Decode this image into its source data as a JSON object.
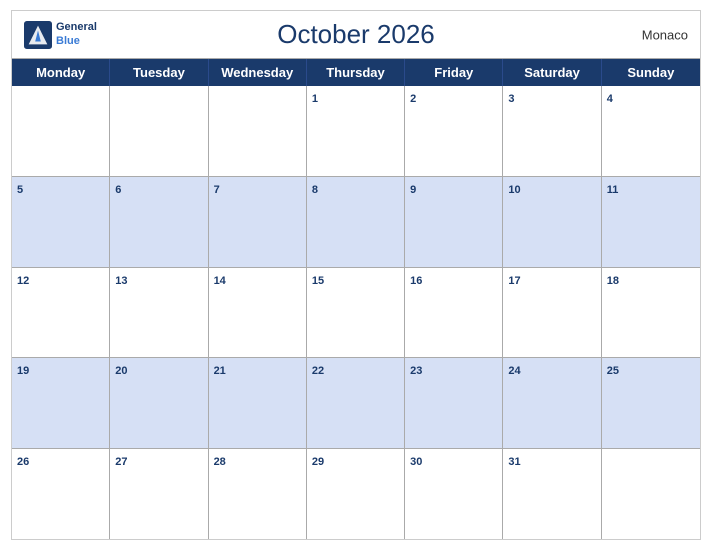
{
  "header": {
    "title": "October 2026",
    "country": "Monaco",
    "logo_general": "General",
    "logo_blue": "Blue"
  },
  "dayHeaders": [
    "Monday",
    "Tuesday",
    "Wednesday",
    "Thursday",
    "Friday",
    "Saturday",
    "Sunday"
  ],
  "weeks": [
    {
      "dark": false,
      "days": [
        {
          "num": "",
          "empty": true
        },
        {
          "num": "",
          "empty": true
        },
        {
          "num": "",
          "empty": true
        },
        {
          "num": "1"
        },
        {
          "num": "2"
        },
        {
          "num": "3"
        },
        {
          "num": "4"
        }
      ]
    },
    {
      "dark": true,
      "days": [
        {
          "num": "5"
        },
        {
          "num": "6"
        },
        {
          "num": "7"
        },
        {
          "num": "8"
        },
        {
          "num": "9"
        },
        {
          "num": "10"
        },
        {
          "num": "11"
        }
      ]
    },
    {
      "dark": false,
      "days": [
        {
          "num": "12"
        },
        {
          "num": "13"
        },
        {
          "num": "14"
        },
        {
          "num": "15"
        },
        {
          "num": "16"
        },
        {
          "num": "17"
        },
        {
          "num": "18"
        }
      ]
    },
    {
      "dark": true,
      "days": [
        {
          "num": "19"
        },
        {
          "num": "20"
        },
        {
          "num": "21"
        },
        {
          "num": "22"
        },
        {
          "num": "23"
        },
        {
          "num": "24"
        },
        {
          "num": "25"
        }
      ]
    },
    {
      "dark": false,
      "days": [
        {
          "num": "26"
        },
        {
          "num": "27"
        },
        {
          "num": "28"
        },
        {
          "num": "29"
        },
        {
          "num": "30"
        },
        {
          "num": "31"
        },
        {
          "num": "",
          "empty": true
        }
      ]
    }
  ]
}
